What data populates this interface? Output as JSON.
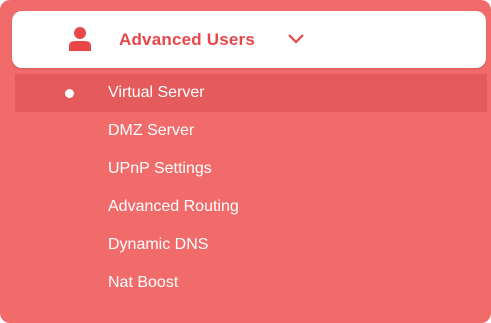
{
  "menu_section": {
    "title": "Advanced Users",
    "icon": "user-icon",
    "expand_icon": "chevron-down-icon",
    "accent_color": "#f26b6b",
    "header_text_color": "#e8474a",
    "active_bg": "#e55a5a"
  },
  "items": [
    {
      "label": "Virtual Server",
      "active": true
    },
    {
      "label": "DMZ Server",
      "active": false
    },
    {
      "label": "UPnP Settings",
      "active": false
    },
    {
      "label": "Advanced Routing",
      "active": false
    },
    {
      "label": "Dynamic DNS",
      "active": false
    },
    {
      "label": "Nat Boost",
      "active": false
    }
  ]
}
